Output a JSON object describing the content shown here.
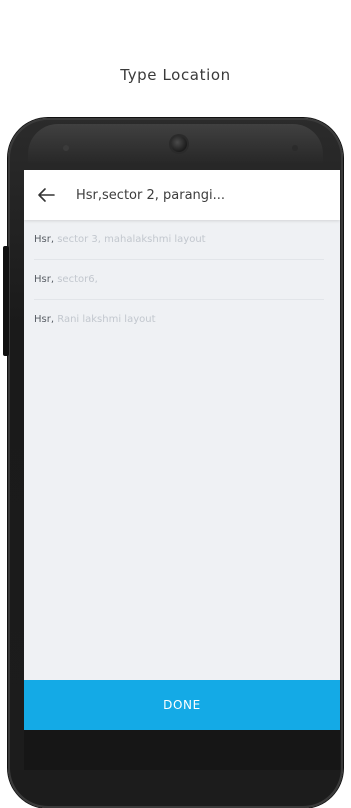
{
  "page": {
    "title": "Type Location"
  },
  "search": {
    "value": "Hsr,sector 2, parangi..."
  },
  "results": [
    {
      "bold": "Hsr,",
      "rest": " sector 3, mahalakshmi layout"
    },
    {
      "bold": "Hsr,",
      "rest": " sector6,"
    },
    {
      "bold": "Hsr,",
      "rest": " Rani lakshmi layout"
    }
  ],
  "actions": {
    "done_label": "DONE"
  },
  "colors": {
    "accent": "#14aae6",
    "screen_bg": "#eff1f4",
    "phone_body": "#1c1c1c"
  },
  "icons": {
    "back": "arrow-left-icon",
    "camera": "camera-icon"
  }
}
